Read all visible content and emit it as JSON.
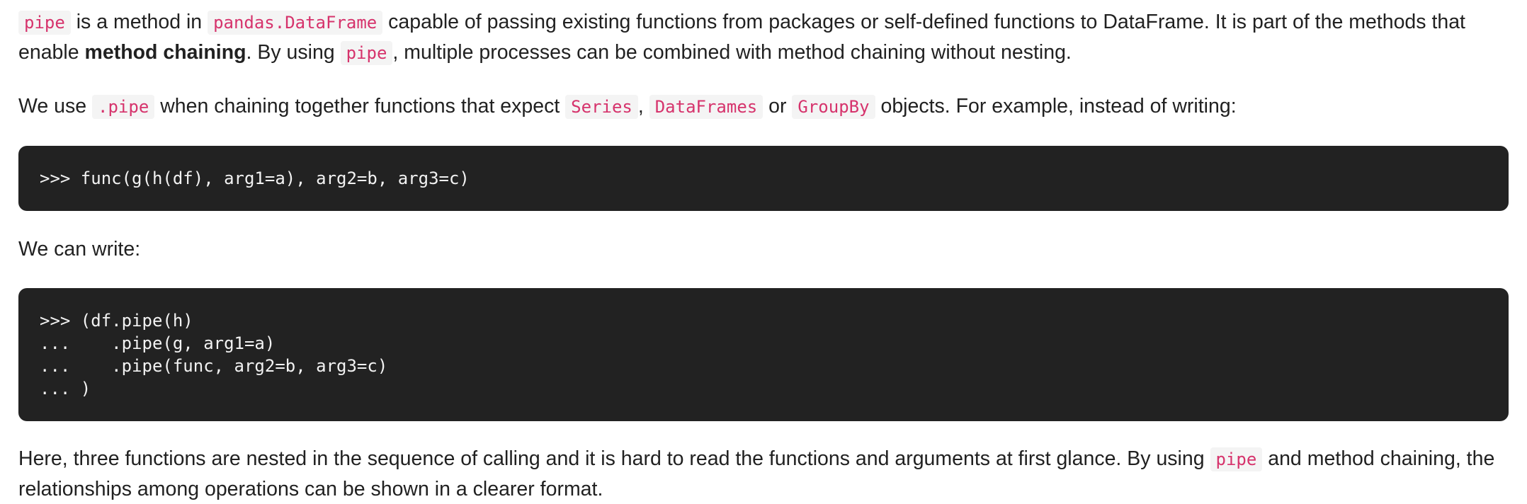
{
  "paragraph1": {
    "code1": "pipe",
    "text1": " is a method in ",
    "code2": "pandas.DataFrame",
    "text2": " capable of passing existing functions from packages or self-defined functions to DataFrame. It is part of the methods that enable ",
    "bold": "method chaining",
    "text3": ". By using ",
    "code3": "pipe",
    "text4": ", multiple processes can be combined with method chaining without nesting."
  },
  "paragraph2": {
    "text1": "We use ",
    "code1": ".pipe",
    "text2": " when chaining together functions that expect ",
    "code2": "Series",
    "text3": ", ",
    "code3": "DataFrames",
    "text4": " or ",
    "code4": "GroupBy",
    "text5": " objects. For example, instead of writing:"
  },
  "code_block1": {
    "lines": [
      ">>> func(g(h(df), arg1=a), arg2=b, arg3=c)"
    ]
  },
  "paragraph3": {
    "text": "We can write:"
  },
  "code_block2": {
    "lines": [
      ">>> (df.pipe(h)",
      "...    .pipe(g, arg1=a)",
      "...    .pipe(func, arg2=b, arg3=c)",
      "... )"
    ]
  },
  "paragraph4": {
    "text1": "Here, three functions are nested in the sequence of calling and it is hard to read the functions and arguments at first glance. By using ",
    "code1": "pipe",
    "text2": " and method chaining, the relationships among operations can be shown in a clearer format."
  }
}
